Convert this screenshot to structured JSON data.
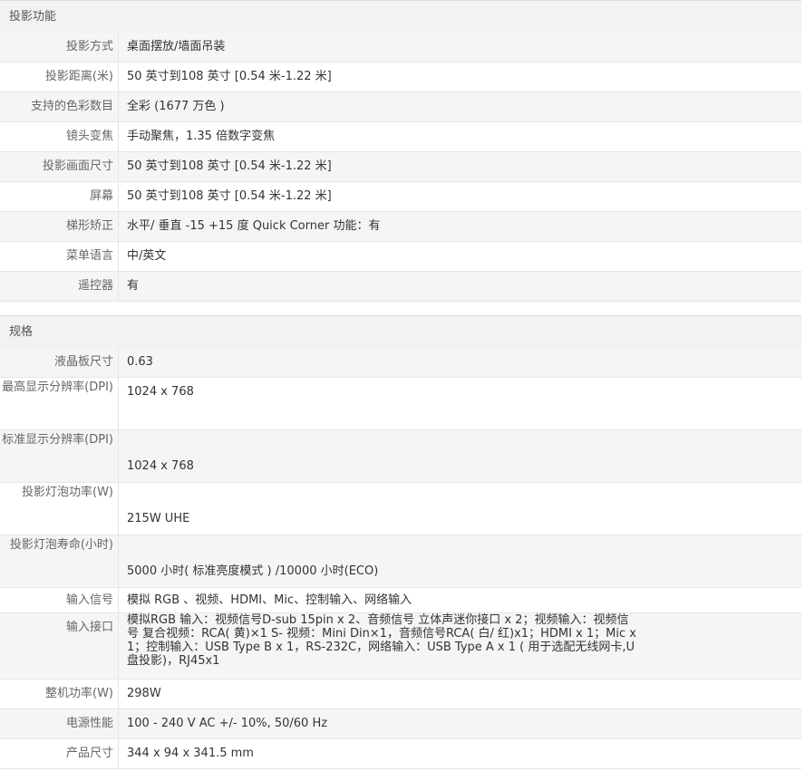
{
  "projection": {
    "section_title": "投影功能",
    "rows": [
      {
        "label": "投影方式",
        "value": "桌面摆放/墙面吊装"
      },
      {
        "label": "投影距离(米)",
        "value": "50 英寸到108 英寸 [0.54 米-1.22 米]"
      },
      {
        "label": "支持的色彩数目",
        "value": "全彩 (1677 万色 )"
      },
      {
        "label": "镜头变焦",
        "value": "手动聚焦，1.35 倍数字变焦"
      },
      {
        "label": "投影画面尺寸",
        "value": "50 英寸到108 英寸 [0.54 米-1.22 米]"
      },
      {
        "label": "屏幕",
        "value": "50 英寸到108 英寸 [0.54 米-1.22 米]"
      },
      {
        "label": "梯形矫正",
        "value": "水平/ 垂直 -15 +15 度 Quick Corner 功能：有"
      },
      {
        "label": "菜单语言",
        "value": "中/英文"
      },
      {
        "label": "遥控器",
        "value": "有"
      }
    ]
  },
  "specs": {
    "section_title": "规格",
    "rows": [
      {
        "label": "液晶板尺寸",
        "value": "0.63"
      },
      {
        "label": "最高显示分辨率(DPI)",
        "value": "1024 x 768"
      },
      {
        "label": "标准显示分辨率(DPI)",
        "value": "1024 x 768"
      },
      {
        "label": "投影灯泡功率(W)",
        "value": "215W UHE"
      },
      {
        "label": "投影灯泡寿命(小时)",
        "value": "5000 小时( 标准亮度模式 ) /10000 小时(ECO)"
      },
      {
        "label": "输入信号",
        "value": "模拟 RGB 、视频、HDMI、Mic、控制输入、网络输入"
      },
      {
        "label": "输入接口",
        "value": "模拟RGB 输入：视频信号D-sub 15pin x 2、音频信号 立体声迷你接口 x 2；视频输入：视频信号 复合视频：RCA( 黄)×1 S- 视频：Mini Din×1，音频信号RCA( 白/ 红)x1；HDMI x 1；Mic x 1；控制输入：USB Type B x 1，RS-232C，网络输入：USB Type A x 1 ( 用于选配无线网卡,U 盘投影)，RJ45x1"
      },
      {
        "label": "整机功率(W)",
        "value": "298W"
      },
      {
        "label": "电源性能",
        "value": "100 - 240 V AC +/- 10%, 50/60 Hz"
      },
      {
        "label": "产品尺寸",
        "value": "344 x 94 x 341.5 mm"
      }
    ]
  }
}
